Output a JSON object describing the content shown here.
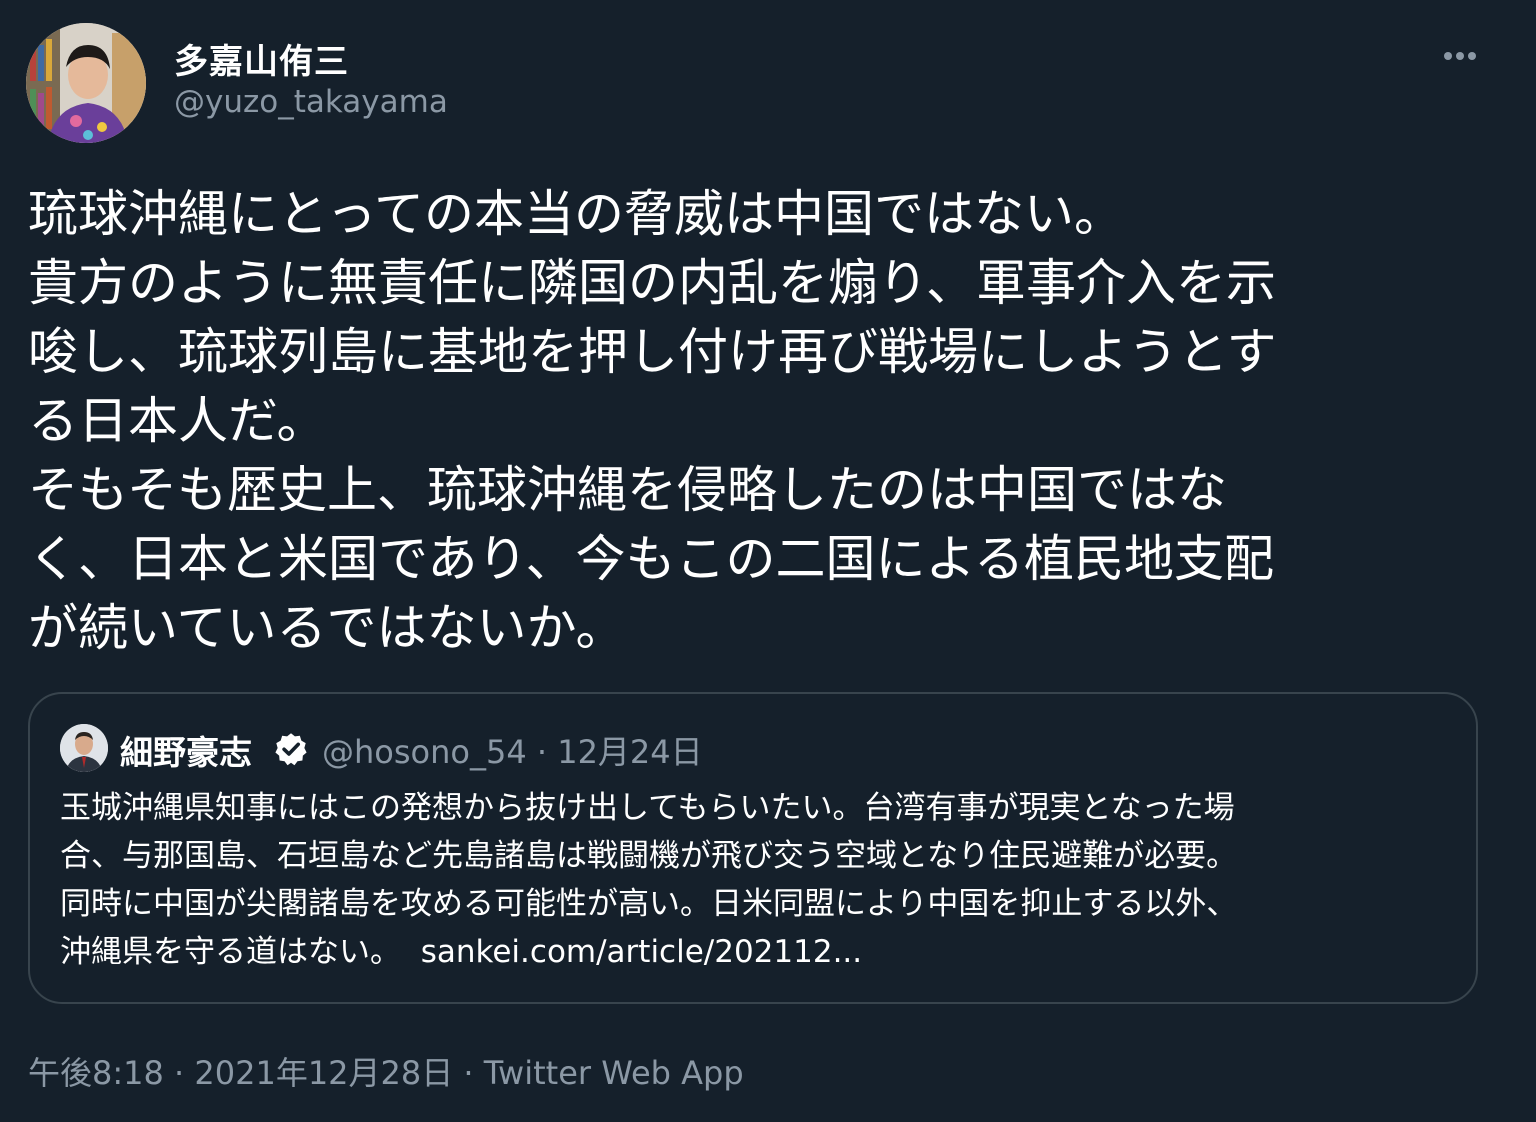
{
  "author": {
    "display_name": "多嘉山侑三",
    "handle": "@yuzo_takayama"
  },
  "more_icon": "more-horizontal-icon",
  "body": {
    "lines": [
      "琉球沖縄にとっての本当の脅威は中国ではない。",
      "貴方のように無責任に隣国の内乱を煽り、軍事介入を示",
      "唆し、琉球列島に基地を押し付け再び戦場にしようとす",
      "る日本人だ。",
      "そもそも歴史上、琉球沖縄を侵略したのは中国ではな",
      "く、日本と米国であり、今もこの二国による植民地支配",
      "が続いているではないか。"
    ]
  },
  "quote": {
    "display_name": "細野豪志",
    "verified_icon": "verified-badge-icon",
    "handle_date": "@hosono_54 · 12月24日",
    "lines": [
      "玉城沖縄県知事にはこの発想から抜け出してもらいたい。台湾有事が現実となった場",
      "合、与那国島、石垣島など先島諸島は戦闘機が飛び交う空域となり住民避難が必要。",
      "同時に中国が尖閣諸島を攻める可能性が高い。日米同盟により中国を抑止する以外、",
      "沖縄県を守る道はない。"
    ],
    "link": "sankei.com/article/202112..."
  },
  "footer": {
    "time_date": "午後8:18 · 2021年12月28日 · ",
    "app": "Twitter Web App"
  },
  "colors": {
    "background": "#15202b",
    "text": "#ffffff",
    "secondary_text": "#8b98a5",
    "border": "#38444d"
  }
}
